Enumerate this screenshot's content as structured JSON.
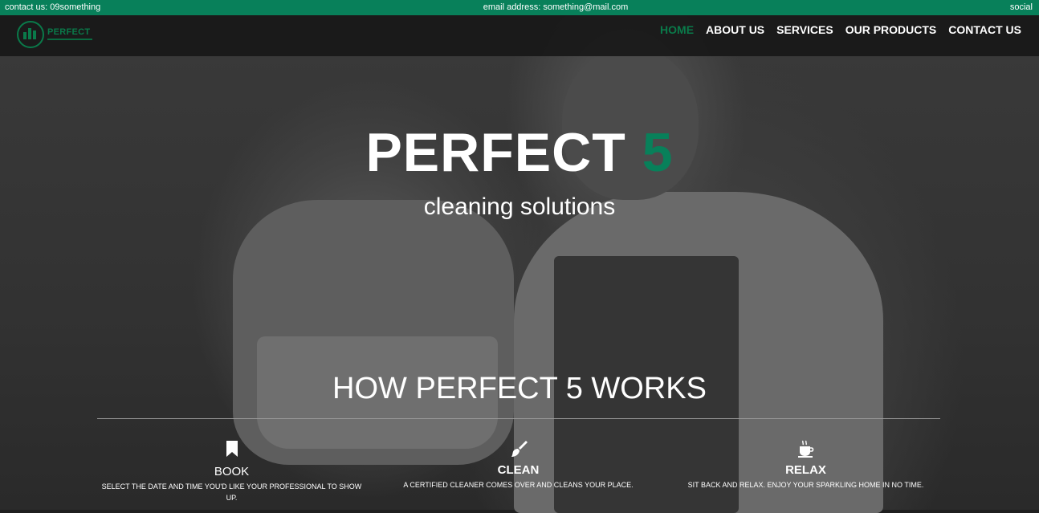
{
  "topbar": {
    "contact": "contact us: 09something",
    "email": "email address: something@mail.com",
    "social": "social"
  },
  "brand": {
    "name": "PERFECT",
    "accent_color": "#08805a"
  },
  "nav": {
    "items": [
      {
        "label": "HOME",
        "active": true
      },
      {
        "label": "ABOUT US",
        "active": false
      },
      {
        "label": "SERVICES",
        "active": false
      },
      {
        "label": "OUR PRODUCTS",
        "active": false
      },
      {
        "label": "CONTACT US",
        "active": false
      }
    ]
  },
  "hero": {
    "title_main": "PERFECT",
    "title_accent": "5",
    "subtitle": "cleaning solutions"
  },
  "how_it_works": {
    "title": "HOW PERFECT 5 WORKS",
    "steps": [
      {
        "icon": "bookmark-icon",
        "label": "BOOK",
        "description": "SELECT THE DATE AND TIME YOU'D LIKE YOUR PROFESSIONAL TO SHOW UP."
      },
      {
        "icon": "broom-icon",
        "label": "CLEAN",
        "description": "A CERTIFIED CLEANER COMES OVER AND CLEANS YOUR PLACE."
      },
      {
        "icon": "coffee-cup-icon",
        "label": "RELAX",
        "description": "SIT BACK AND RELAX. ENJOY YOUR SPARKLING HOME IN NO TIME."
      }
    ]
  }
}
